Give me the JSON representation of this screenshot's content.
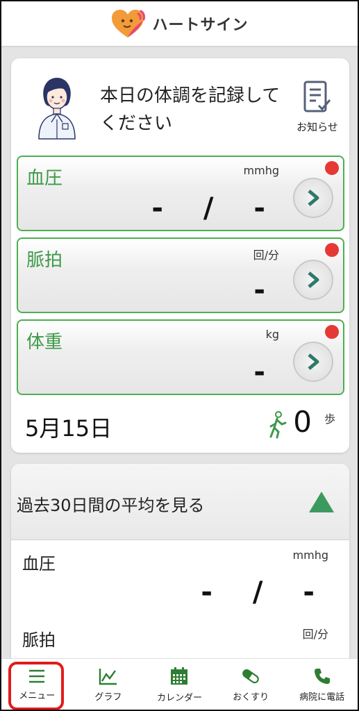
{
  "header": {
    "app_name": "ハートサイン",
    "logo_icon": "heart-face-logo"
  },
  "prompt": {
    "text": "本日の体調を記録してください"
  },
  "notice": {
    "label": "お知らせ",
    "icon": "clipboard-check-icon"
  },
  "metrics": [
    {
      "title": "血圧",
      "unit": "mmhg",
      "value": "- / -"
    },
    {
      "title": "脈拍",
      "unit": "回/分",
      "value": "-"
    },
    {
      "title": "体重",
      "unit": "kg",
      "value": "-"
    }
  ],
  "date": "5月15日",
  "steps": {
    "count": "0",
    "unit": "歩"
  },
  "average": {
    "title": "過去30日間の平均を見る",
    "rows": [
      {
        "label": "血圧",
        "unit": "mmhg",
        "value": "- / -"
      },
      {
        "label": "脈拍",
        "unit": "回/分"
      }
    ]
  },
  "nav": {
    "items": [
      {
        "label": "メニュー",
        "icon": "menu-icon"
      },
      {
        "label": "グラフ",
        "icon": "chart-icon"
      },
      {
        "label": "カレンダー",
        "icon": "calendar-icon"
      },
      {
        "label": "おくすり",
        "icon": "pill-icon"
      },
      {
        "label": "病院に電話",
        "icon": "phone-icon"
      }
    ]
  },
  "colors": {
    "accent_green": "#3d9a4a",
    "alert_red": "#e53935",
    "highlight_red": "#e31b1b"
  }
}
